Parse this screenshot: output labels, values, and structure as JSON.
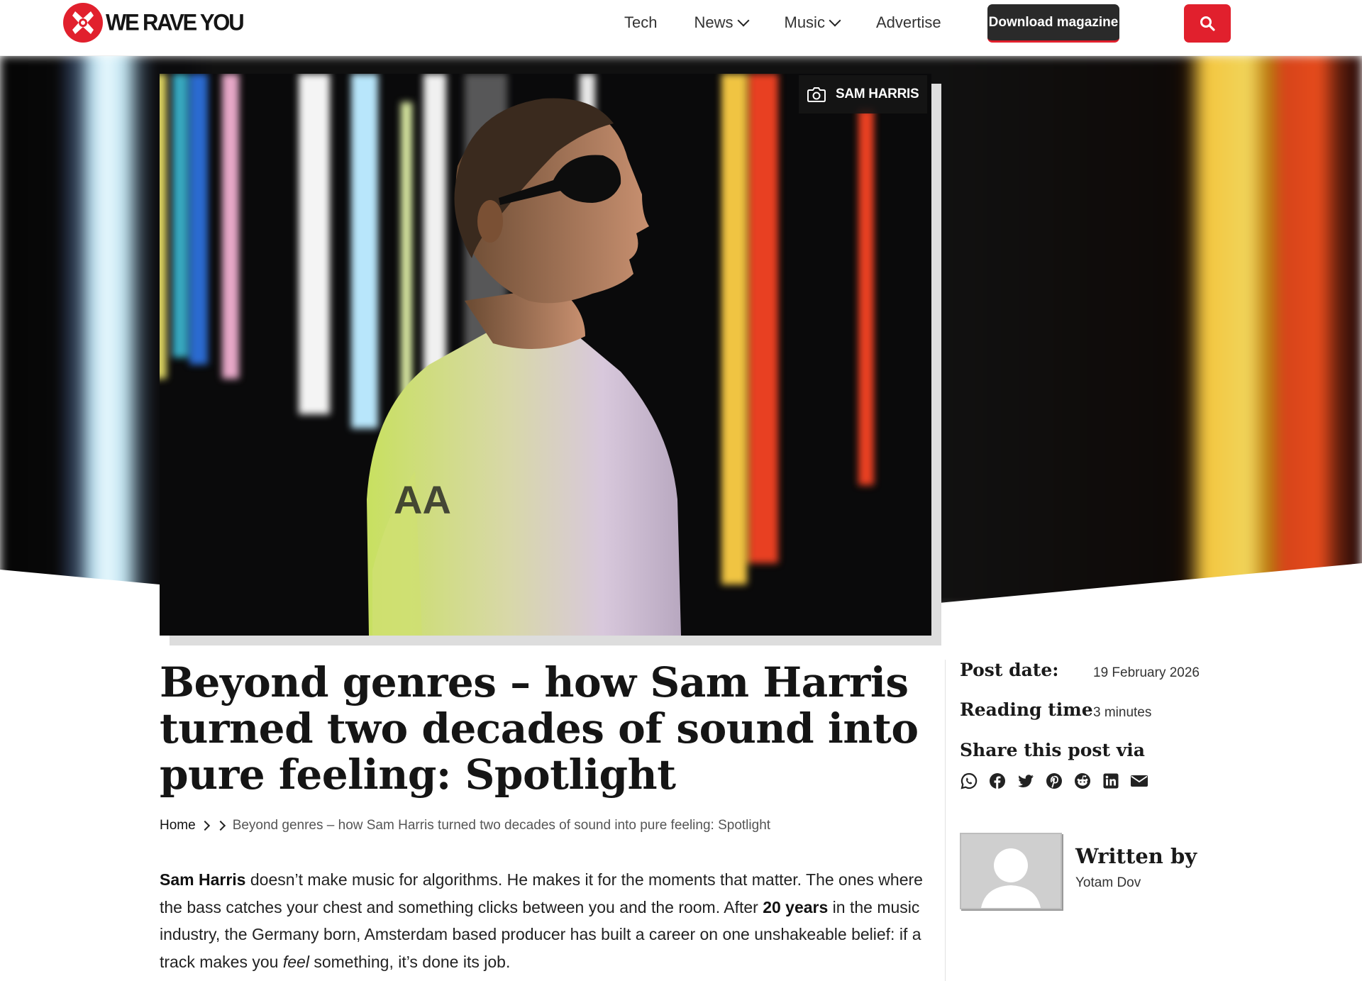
{
  "header": {
    "logo_text": "WE RAVE YOU",
    "nav": [
      {
        "label": "Tech"
      },
      {
        "label": "News"
      },
      {
        "label": "Music"
      },
      {
        "label": "Advertise"
      }
    ],
    "download_label": "Download magazine",
    "accent_color": "#e1202d"
  },
  "hero": {
    "photo_credit": "SAM HARRIS"
  },
  "article": {
    "title": "Beyond genres – how Sam Harris turned two decades of sound into pure feeling: Spotlight",
    "breadcrumb": {
      "home": "Home",
      "current": "Beyond genres – how Sam Harris turned two decades of sound into pure feeling: Spotlight"
    },
    "intro": {
      "bold_name": "Sam Harris",
      "text_1": " doesn’t make music for algorithms. He makes it for the moments that matter. The ones where the bass catches your chest and something clicks between you and the room. After ",
      "bold_years": "20 years",
      "text_2": " in the music industry, the Germany born, Amsterdam based producer has built a career on one unshakeable belief: if a track makes you ",
      "italic_word": "feel",
      "text_3": " something, it’s done its job."
    }
  },
  "sidebar": {
    "post_date_label": "Post date:",
    "post_date": "19 February 2026",
    "reading_time_label": "Reading time",
    "reading_time": "3 minutes",
    "share_label": "Share this post via",
    "share_icons": [
      "whatsapp-icon",
      "facebook-icon",
      "twitter-icon",
      "pinterest-icon",
      "reddit-icon",
      "linkedin-icon",
      "email-icon"
    ],
    "written_by_label": "Written by",
    "author": "Yotam Dov"
  }
}
